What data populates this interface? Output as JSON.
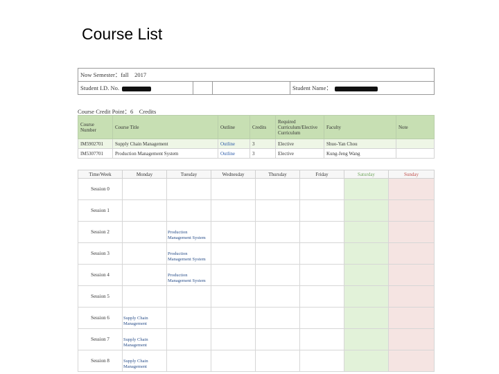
{
  "title": "Course List",
  "student_info": {
    "semester_label": "Now Semester：fall　2017",
    "id_label": "Student I.D. No.",
    "name_label": "Student Name："
  },
  "credit_line": "Course Credit Point：6　Credits",
  "courses": {
    "headers": [
      "Course Number",
      "Course Title",
      "Outline",
      "Credits",
      "Required Curriculum/Elective Curriculum",
      "Faculty",
      "Note"
    ],
    "rows": [
      [
        "IM5902701",
        "Supply Chain Management",
        "Outline",
        "3",
        "Elective",
        "Shuo-Yan Chou",
        ""
      ],
      [
        "IM5307701",
        "Production Management System",
        "Outline",
        "3",
        "Elective",
        "Kung-Jeng Wang",
        ""
      ]
    ]
  },
  "timetable": {
    "headers": [
      "Time/Week",
      "Monday",
      "Tuesday",
      "Wednesday",
      "Thursday",
      "Friday",
      "Saturday",
      "Sunday"
    ],
    "sessions": [
      {
        "label": "Session 0",
        "cells": [
          "",
          "",
          "",
          "",
          "",
          "",
          ""
        ]
      },
      {
        "label": "Session 1",
        "cells": [
          "",
          "",
          "",
          "",
          "",
          "",
          ""
        ]
      },
      {
        "label": "Session 2",
        "cells": [
          "",
          "Production Management System",
          "",
          "",
          "",
          "",
          ""
        ]
      },
      {
        "label": "Session 3",
        "cells": [
          "",
          "Production Management System",
          "",
          "",
          "",
          "",
          ""
        ]
      },
      {
        "label": "Session 4",
        "cells": [
          "",
          "Production Management System",
          "",
          "",
          "",
          "",
          ""
        ]
      },
      {
        "label": "Session 5",
        "cells": [
          "",
          "",
          "",
          "",
          "",
          "",
          ""
        ]
      },
      {
        "label": "Session 6",
        "cells": [
          "Supply Chain Management",
          "",
          "",
          "",
          "",
          "",
          ""
        ]
      },
      {
        "label": "Session 7",
        "cells": [
          "Supply Chain Management",
          "",
          "",
          "",
          "",
          "",
          ""
        ]
      },
      {
        "label": "Session 8",
        "cells": [
          "Supply Chain Management",
          "",
          "",
          "",
          "",
          "",
          ""
        ]
      }
    ]
  },
  "colors": {
    "course_header_bg": "#c7dfb3",
    "link": "#2a5aa8",
    "saturday_bg": "#e2f2d9",
    "sunday_bg": "#f5e4e2"
  }
}
